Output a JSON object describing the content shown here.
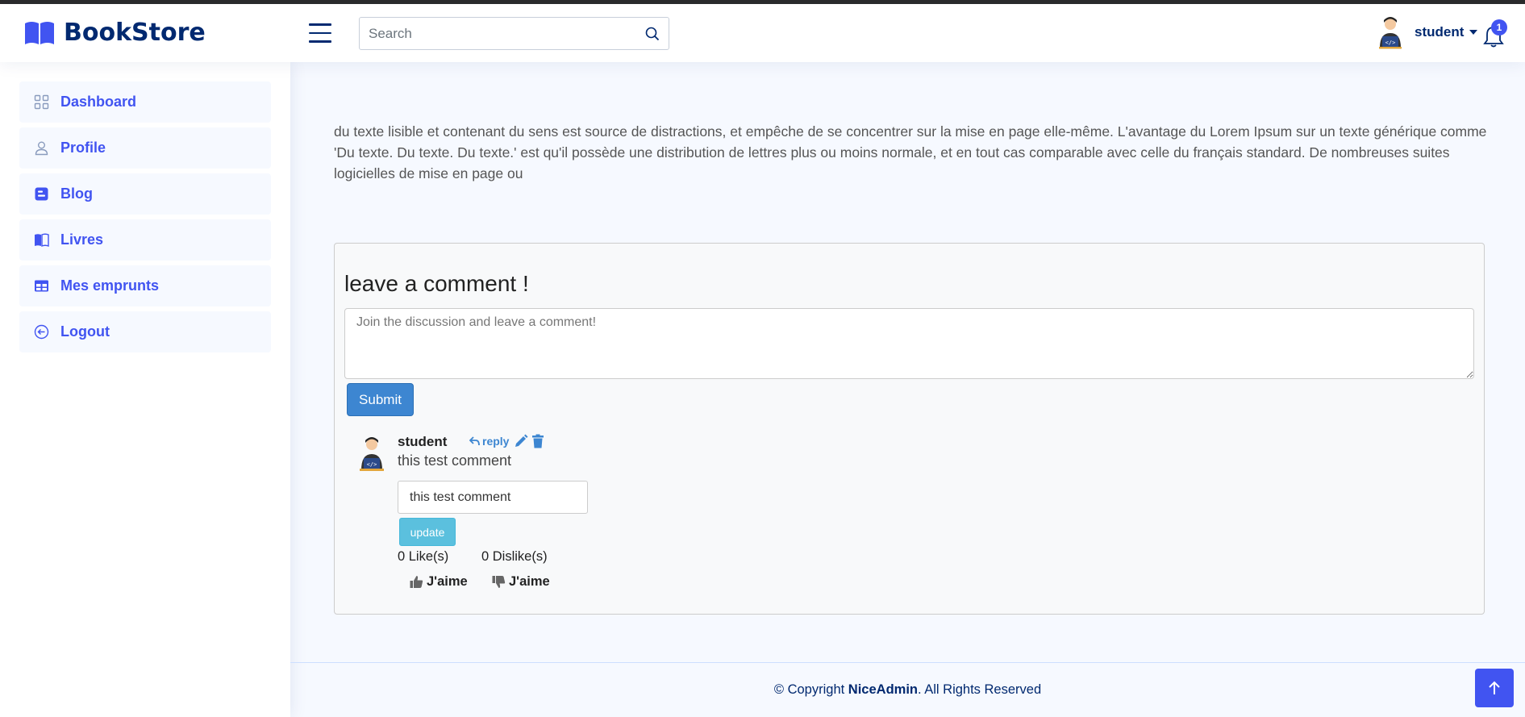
{
  "app": {
    "name": "BookStore"
  },
  "header": {
    "search_placeholder": "Search",
    "username": "student",
    "notification_count": "1"
  },
  "sidebar": {
    "items": [
      {
        "label": "Dashboard",
        "icon": "grid-icon"
      },
      {
        "label": "Profile",
        "icon": "person-icon"
      },
      {
        "label": "Blog",
        "icon": "blogger-icon"
      },
      {
        "label": "Livres",
        "icon": "book-icon"
      },
      {
        "label": "Mes emprunts",
        "icon": "table-icon"
      },
      {
        "label": "Logout",
        "icon": "arrow-left-circle-icon"
      }
    ]
  },
  "main": {
    "paragraph": "du texte lisible et contenant du sens est source de distractions, et empêche de se concentrer sur la mise en page elle-même. L'avantage du Lorem Ipsum sur un texte générique comme 'Du texte. Du texte. Du texte.' est qu'il possède une distribution de lettres plus ou moins normale, et en tout cas comparable avec celle du français standard. De nombreuses suites logicielles de mise en page ou"
  },
  "comments": {
    "title": "leave a comment !",
    "textarea_placeholder": "Join the discussion and leave a comment!",
    "submit_label": "Submit",
    "items": [
      {
        "author": "student",
        "reply_label": "reply",
        "text": "this test comment",
        "edit_value": "this test comment",
        "update_label": "update",
        "likes": "0 Like(s)",
        "dislikes": "0 Dislike(s)",
        "like_label": "J'aime",
        "dislike_label": "J'aime"
      }
    ]
  },
  "footer": {
    "prefix": "© Copyright ",
    "brand": "NiceAdmin",
    "suffix": ". All Rights Reserved"
  },
  "colors": {
    "brand": "#012970",
    "accent": "#4154f1",
    "submit": "#3d86d1",
    "update": "#5bc0de"
  }
}
